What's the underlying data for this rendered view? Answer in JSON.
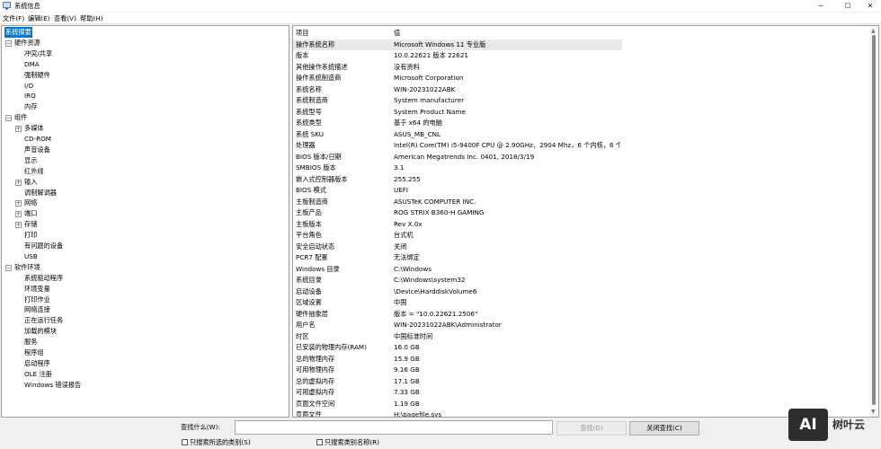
{
  "window": {
    "title": "系统信息",
    "minimize": "─",
    "maximize": "☐",
    "close": "✕"
  },
  "menu": [
    "文件(F)",
    "编辑(E)",
    "查看(V)",
    "帮助(H)"
  ],
  "tree": [
    {
      "label": "系统摘要",
      "level": 0,
      "selected": true
    },
    {
      "label": "硬件资源",
      "level": 0,
      "expander": "−"
    },
    {
      "label": "冲突/共享",
      "level": 2
    },
    {
      "label": "DMA",
      "level": 2
    },
    {
      "label": "强制硬件",
      "level": 2
    },
    {
      "label": "I/O",
      "level": 2
    },
    {
      "label": "IRQ",
      "level": 2
    },
    {
      "label": "内存",
      "level": 2
    },
    {
      "label": "组件",
      "level": 0,
      "expander": "−"
    },
    {
      "label": "多媒体",
      "level": 1,
      "expander": "+"
    },
    {
      "label": "CD-ROM",
      "level": 2
    },
    {
      "label": "声音设备",
      "level": 2
    },
    {
      "label": "显示",
      "level": 2
    },
    {
      "label": "红外线",
      "level": 2
    },
    {
      "label": "输入",
      "level": 1,
      "expander": "+"
    },
    {
      "label": "调制解调器",
      "level": 2
    },
    {
      "label": "网络",
      "level": 1,
      "expander": "+"
    },
    {
      "label": "端口",
      "level": 1,
      "expander": "+"
    },
    {
      "label": "存储",
      "level": 1,
      "expander": "+"
    },
    {
      "label": "打印",
      "level": 2
    },
    {
      "label": "有问题的设备",
      "level": 2
    },
    {
      "label": "USB",
      "level": 2
    },
    {
      "label": "软件环境",
      "level": 0,
      "expander": "−"
    },
    {
      "label": "系统驱动程序",
      "level": 2
    },
    {
      "label": "环境变量",
      "level": 2
    },
    {
      "label": "打印作业",
      "level": 2
    },
    {
      "label": "网络连接",
      "level": 2
    },
    {
      "label": "正在运行任务",
      "level": 2
    },
    {
      "label": "加载的模块",
      "level": 2
    },
    {
      "label": "服务",
      "level": 2
    },
    {
      "label": "程序组",
      "level": 2
    },
    {
      "label": "启动程序",
      "level": 2
    },
    {
      "label": "OLE 注册",
      "level": 2
    },
    {
      "label": "Windows 错误报告",
      "level": 2
    }
  ],
  "details": {
    "headers": {
      "item": "项目",
      "value": "值"
    },
    "rows": [
      {
        "item": "操作系统名称",
        "value": "Microsoft Windows 11 专业版"
      },
      {
        "item": "版本",
        "value": "10.0.22621 版本 22621"
      },
      {
        "item": "其他操作系统描述",
        "value": "没有资料"
      },
      {
        "item": "操作系统制造商",
        "value": "Microsoft Corporation"
      },
      {
        "item": "系统名称",
        "value": "WIN-20231022ABK"
      },
      {
        "item": "系统制造商",
        "value": "System manufacturer"
      },
      {
        "item": "系统型号",
        "value": "System Product Name"
      },
      {
        "item": "系统类型",
        "value": "基于 x64 的电脑"
      },
      {
        "item": "系统 SKU",
        "value": "ASUS_MB_CNL"
      },
      {
        "item": "处理器",
        "value": "Intel(R) Core(TM) i5-9400F CPU @ 2.90GHz，2904 Mhz，6 个内核，6 个..."
      },
      {
        "item": "BIOS 版本/日期",
        "value": "American Megatrends Inc. 0401, 2018/3/19"
      },
      {
        "item": "SMBIOS 版本",
        "value": "3.1"
      },
      {
        "item": "嵌入式控制器版本",
        "value": "255.255"
      },
      {
        "item": "BIOS 模式",
        "value": "UEFI"
      },
      {
        "item": "主板制造商",
        "value": "ASUSTeK COMPUTER INC."
      },
      {
        "item": "主板产品",
        "value": "ROG STRIX B360-H GAMING"
      },
      {
        "item": "主板版本",
        "value": "Rev X.0x"
      },
      {
        "item": "平台角色",
        "value": "台式机"
      },
      {
        "item": "安全启动状态",
        "value": "关闭"
      },
      {
        "item": "PCR7 配置",
        "value": "无法绑定"
      },
      {
        "item": "Windows 目录",
        "value": "C:\\Windows"
      },
      {
        "item": "系统目录",
        "value": "C:\\Windows\\system32"
      },
      {
        "item": "启动设备",
        "value": "\\Device\\HarddiskVolume6"
      },
      {
        "item": "区域设置",
        "value": "中国"
      },
      {
        "item": "硬件抽象层",
        "value": "版本 = \"10.0.22621.2506\""
      },
      {
        "item": "用户名",
        "value": "WIN-20231022ABK\\Administrator"
      },
      {
        "item": "时区",
        "value": "中国标准时间"
      },
      {
        "item": "已安装的物理内存(RAM)",
        "value": "16.0 GB"
      },
      {
        "item": "总的物理内存",
        "value": "15.9 GB"
      },
      {
        "item": "可用物理内存",
        "value": "9.16 GB"
      },
      {
        "item": "总的虚拟内存",
        "value": "17.1 GB"
      },
      {
        "item": "可用虚拟内存",
        "value": "7.33 GB"
      },
      {
        "item": "页面文件空间",
        "value": "1.19 GB"
      },
      {
        "item": "页面文件",
        "value": "H:\\pagefile.sys"
      }
    ]
  },
  "search": {
    "label": "查找什么(W):",
    "value": "",
    "find_button": "查找(D)",
    "close_button": "关闭查找(C)",
    "checkbox_selected": "只搜索所选的类别(S)",
    "checkbox_names": "只搜索类别名称(R)"
  },
  "watermark": {
    "logo": "AI",
    "text": "树叶云"
  }
}
